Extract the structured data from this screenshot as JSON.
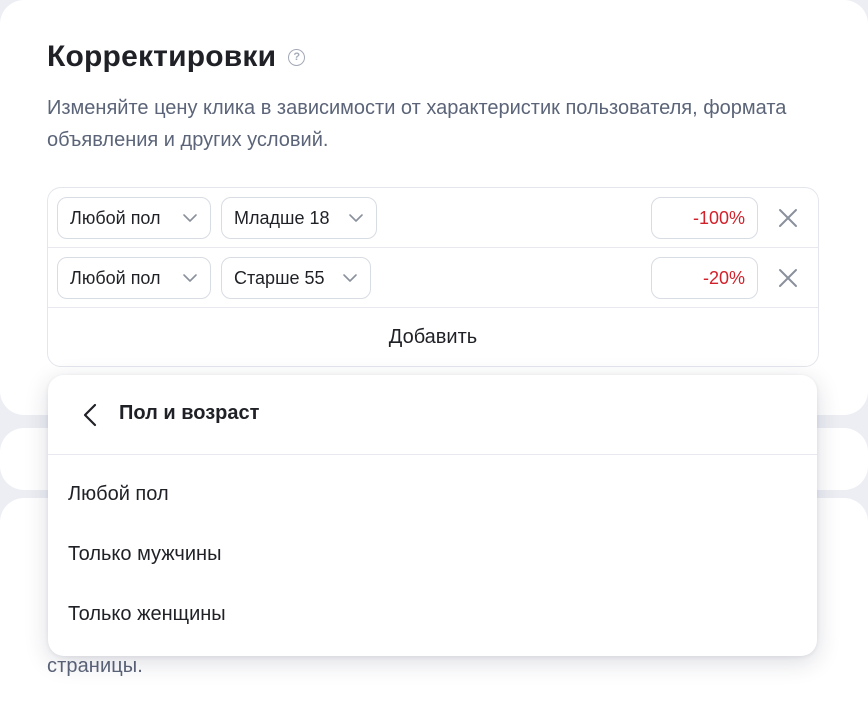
{
  "section": {
    "title": "Корректировки",
    "help_icon": "?",
    "subtitle": "Изменяйте цену клика в зависимости от характеристик пользователя, формата объявления и других условий."
  },
  "rules": [
    {
      "gender": "Любой пол",
      "age": "Младше 18",
      "percent": "-100%"
    },
    {
      "gender": "Любой пол",
      "age": "Старше 55",
      "percent": "-20%"
    }
  ],
  "add_label": "Добавить",
  "dropdown": {
    "title": "Пол и возраст",
    "options": [
      "Любой пол",
      "Только мужчины",
      "Только женщины"
    ]
  },
  "bottom_text": "страницы.",
  "colors": {
    "negative": "#d2212a",
    "muted_text": "#5b6478",
    "border": "#d8dce3"
  }
}
